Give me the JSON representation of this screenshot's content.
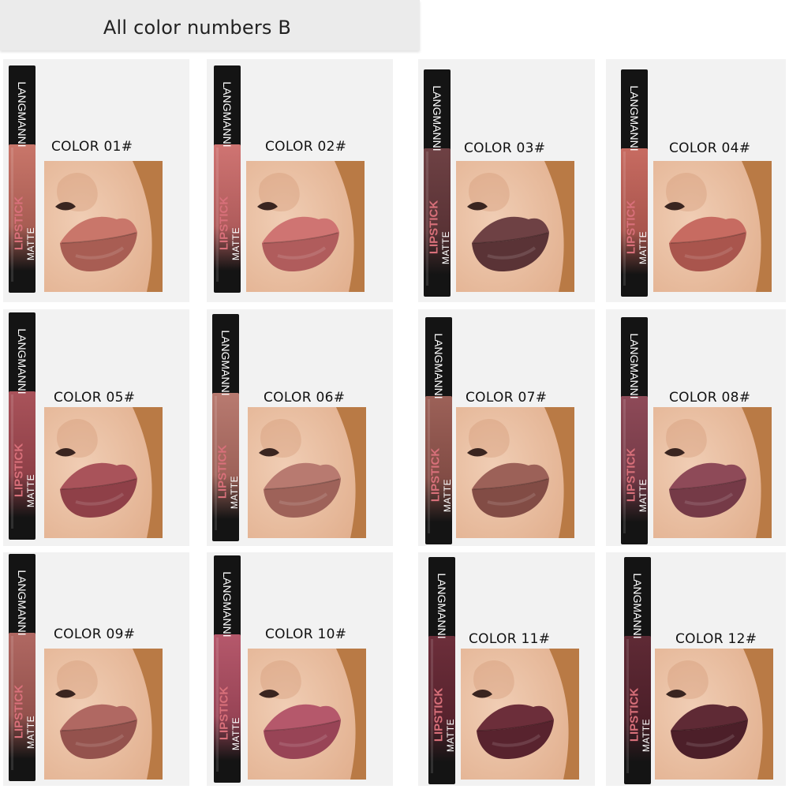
{
  "header": {
    "title": "All color numbers  B"
  },
  "product": {
    "brand": "LANGMANNI",
    "line1": "MATTE",
    "line2": "LIPSTICK"
  },
  "colors": {
    "skin_light": "#f0cdb4",
    "skin_mid": "#e2b08f",
    "background_brown": "#b97a45",
    "tube_black": "#141414"
  },
  "swatches": [
    {
      "label": "COLOR 01#",
      "lip": "#c9766a",
      "lip_dark": "#a85d53"
    },
    {
      "label": "COLOR 02#",
      "lip": "#cf7472",
      "lip_dark": "#b05c5c"
    },
    {
      "label": "COLOR 03#",
      "lip": "#6e4144",
      "lip_dark": "#5a3336"
    },
    {
      "label": "COLOR 04#",
      "lip": "#c76b61",
      "lip_dark": "#a9554d"
    },
    {
      "label": "COLOR 05#",
      "lip": "#a9535a",
      "lip_dark": "#8f4048"
    },
    {
      "label": "COLOR 06#",
      "lip": "#b87a70",
      "lip_dark": "#9e6259"
    },
    {
      "label": "COLOR 07#",
      "lip": "#9c6158",
      "lip_dark": "#824c45"
    },
    {
      "label": "COLOR 08#",
      "lip": "#8e4a58",
      "lip_dark": "#753a47"
    },
    {
      "label": "COLOR 09#",
      "lip": "#b06862",
      "lip_dark": "#94524d"
    },
    {
      "label": "COLOR 10#",
      "lip": "#b5586b",
      "lip_dark": "#984456"
    },
    {
      "label": "COLOR 11#",
      "lip": "#6c2e3a",
      "lip_dark": "#58232e"
    },
    {
      "label": "COLOR 12#",
      "lip": "#5f2a35",
      "lip_dark": "#4c1f29"
    }
  ]
}
